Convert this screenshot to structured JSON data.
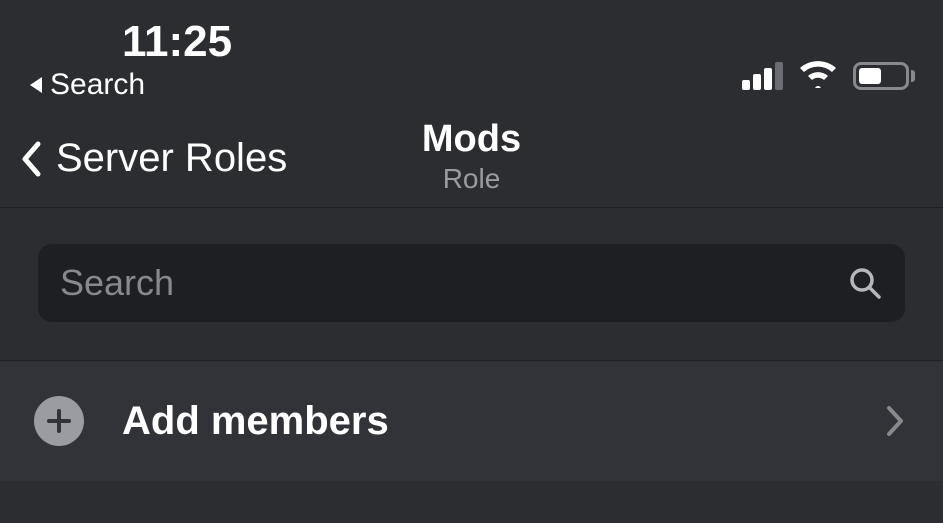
{
  "status_bar": {
    "time": "11:25",
    "back_label": "Search"
  },
  "nav": {
    "back_label": "Server Roles",
    "title": "Mods",
    "subtitle": "Role"
  },
  "search": {
    "placeholder": "Search"
  },
  "add_members": {
    "label": "Add members"
  }
}
